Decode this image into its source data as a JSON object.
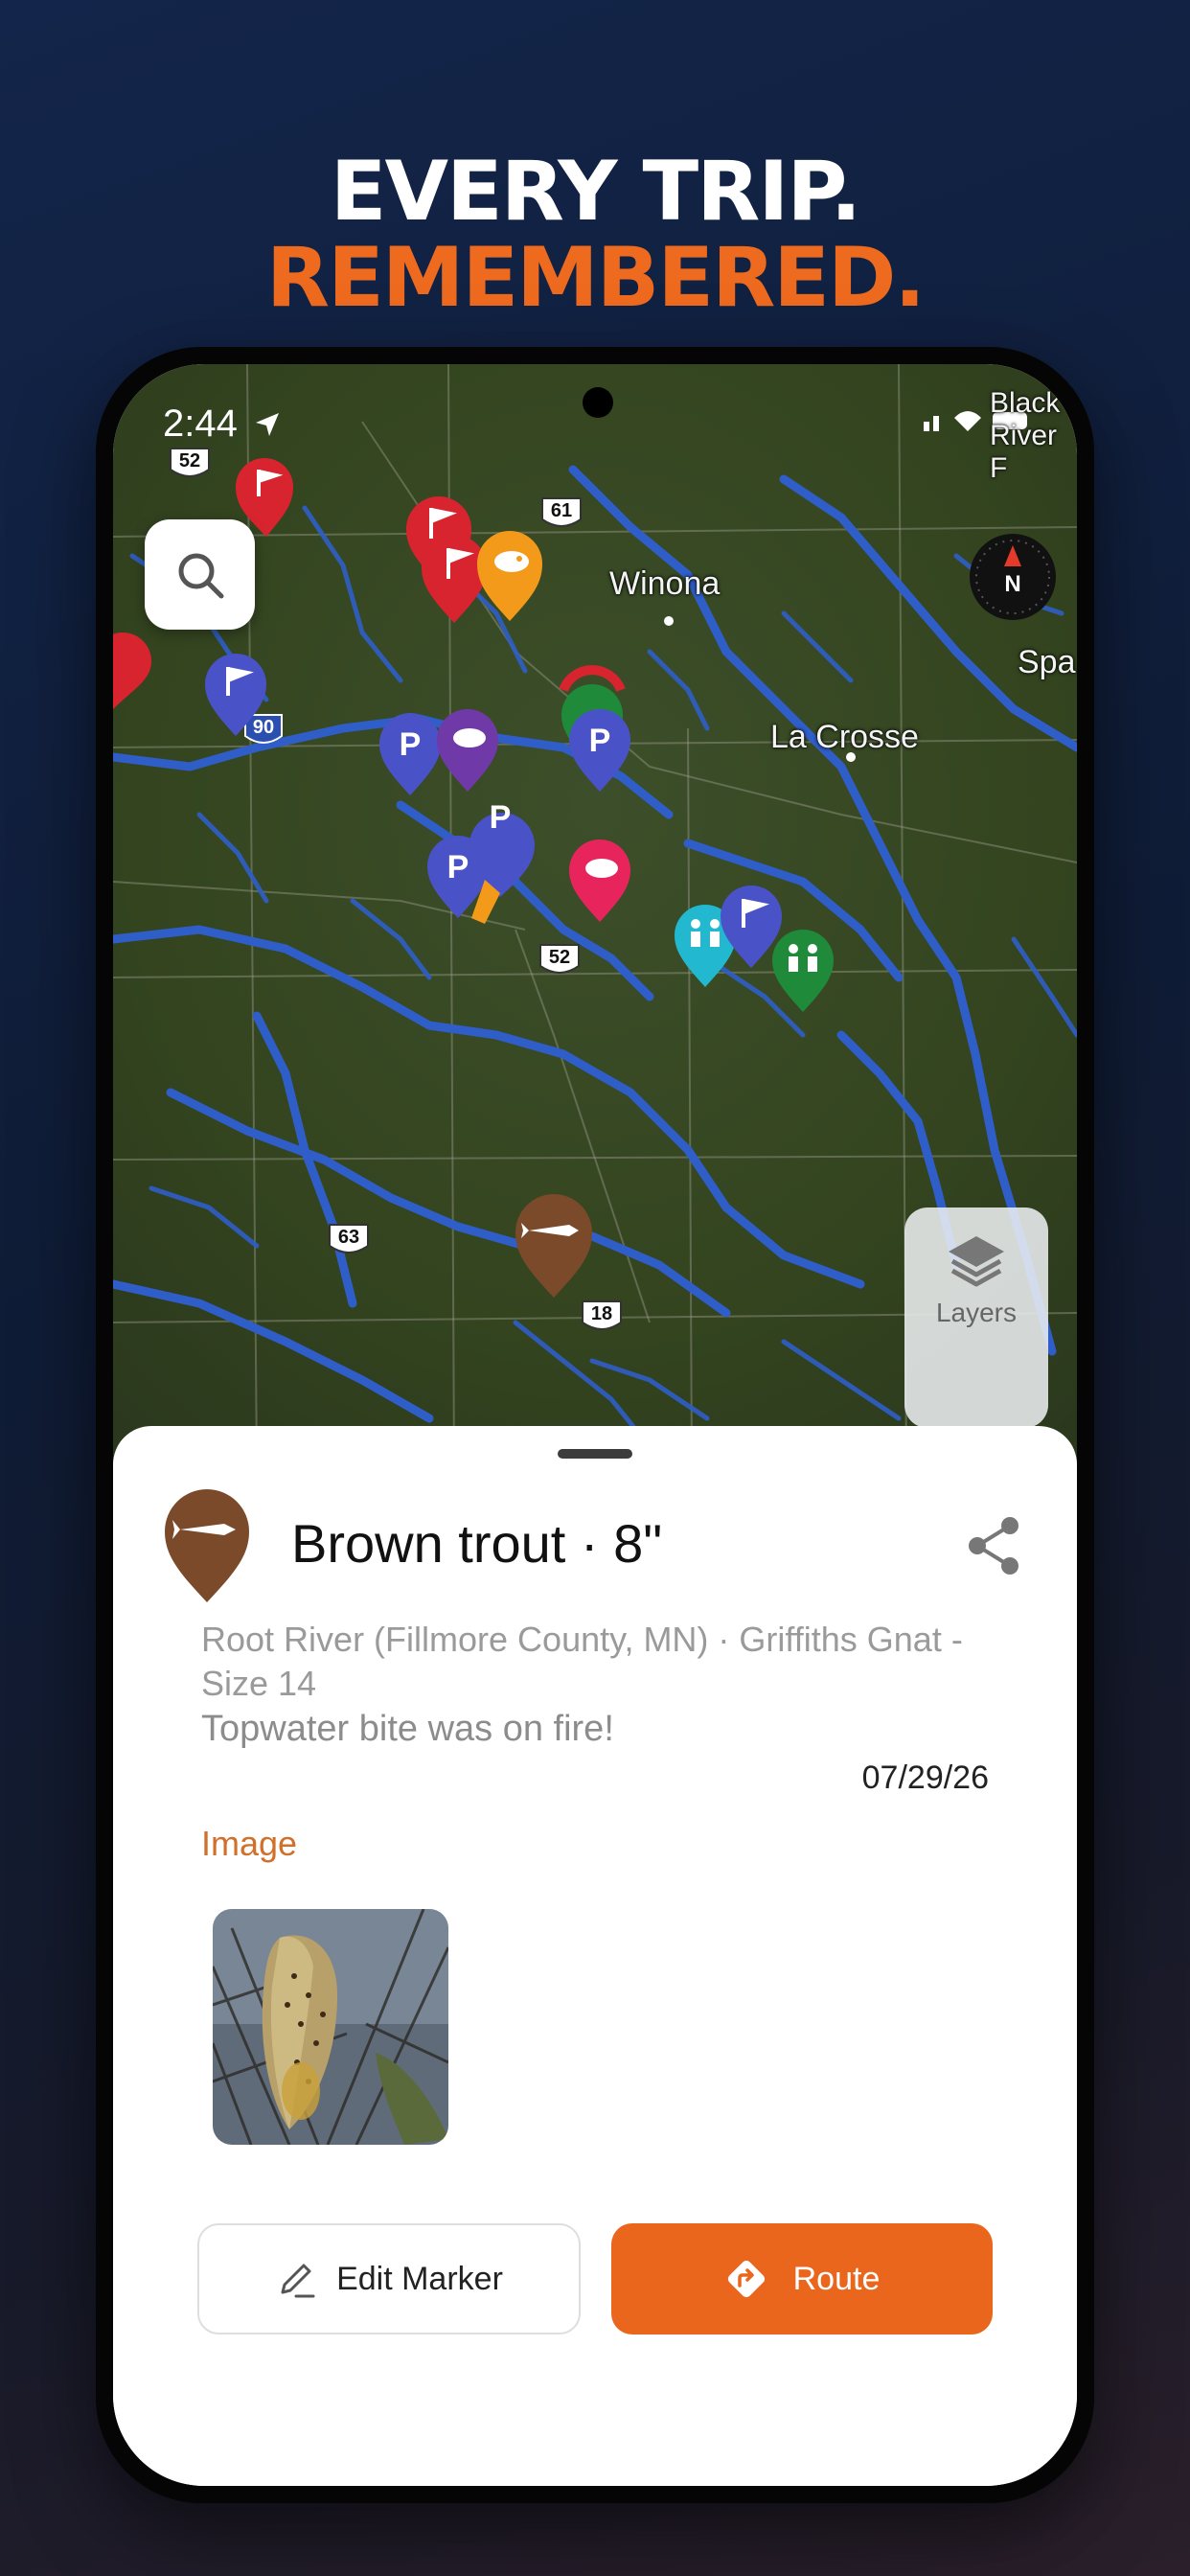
{
  "headline": {
    "line1": "EVERY TRIP.",
    "line2": "REMEMBERED."
  },
  "status_bar": {
    "time": "2:44",
    "carrier_fragment": "Bla"
  },
  "map": {
    "labels": {
      "winona": "Winona",
      "la_crosse": "La Crosse",
      "spa": "Spa",
      "black_river_falls": "Black River F"
    },
    "route_shields": [
      "52",
      "61",
      "90",
      "52",
      "63",
      "18"
    ],
    "compass_letter": "N",
    "layers_label": "Layers"
  },
  "catch": {
    "title": "Brown trout · 8\"",
    "location": "Root River (Fillmore County, MN)  ·  Griffiths Gnat - Size 14",
    "note": "Topwater bite was on fire!",
    "date": "07/29/26",
    "image_section_label": "Image"
  },
  "actions": {
    "edit_label": "Edit Marker",
    "route_label": "Route"
  },
  "colors": {
    "accent": "#ea661c",
    "headline_orange": "#ee6a1f",
    "river_blue": "#2f5ec8",
    "pin_brown": "#7a4a2a",
    "pin_red": "#d8242f",
    "pin_blue": "#4a52c8",
    "pin_orange": "#f49a1a",
    "pin_purple": "#6f3aa8",
    "pin_pink": "#e8245c",
    "pin_teal": "#22b8cf",
    "pin_green": "#1f8a3a"
  }
}
